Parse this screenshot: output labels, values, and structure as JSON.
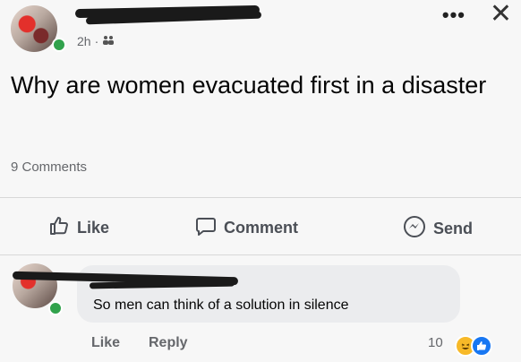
{
  "post": {
    "time": "2h",
    "separator": "·",
    "audience_icon": "friends-icon",
    "text": "Why are women evacuated first in a disaster",
    "comments_count": "9 Comments"
  },
  "actions": {
    "like": "Like",
    "comment": "Comment",
    "send": "Send"
  },
  "comment": {
    "text": "So men can think of a solution in silence",
    "like": "Like",
    "reply": "Reply",
    "reaction_count": "10",
    "reactions": [
      "laugh-icon",
      "like-icon"
    ]
  },
  "colors": {
    "online": "#31a24c",
    "like_blue": "#1877f2",
    "laugh_yellow": "#f7b928"
  }
}
